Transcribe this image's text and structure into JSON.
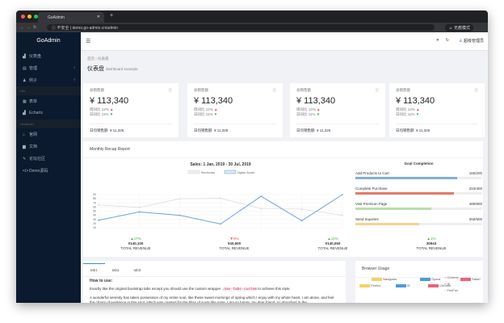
{
  "browser": {
    "tab_title": "GoAdmin",
    "url_security": "不安全",
    "url": "demo.go-admin.cn/admin",
    "profile": "无痕模式"
  },
  "sidebar": {
    "logo": "GoAdmin",
    "items": [
      {
        "label": "仪表盘",
        "icon": "dashboard-icon"
      },
      {
        "label": "管理",
        "icon": "table-icon",
        "chevron": "‹"
      },
      {
        "label": "例子",
        "icon": "user-icon",
        "chevron": "‹"
      }
    ],
    "header1": "Life",
    "items2": [
      {
        "label": "表单",
        "icon": "form-icon"
      },
      {
        "label": "Echarts",
        "icon": "chart-icon"
      }
    ],
    "header2": "GoAdmin",
    "items3": [
      {
        "label": "官网",
        "icon": "home-icon"
      },
      {
        "label": "文档",
        "icon": "doc-icon"
      },
      {
        "label": "论坛社区",
        "icon": "forum-icon"
      },
      {
        "label": "Demo源码",
        "icon": "code-icon"
      }
    ]
  },
  "header": {
    "user": "超级管理员"
  },
  "breadcrumb": [
    "首页",
    "仪表盘"
  ],
  "page": {
    "title": "仪表盘",
    "subtitle": "dashboard example"
  },
  "cards": [
    {
      "title": "总销售额",
      "value": "¥ 113,340",
      "wow_label": "周同比",
      "wow": "12%",
      "dod_label": "日同比",
      "dod": "11%",
      "footer_label": "日均销售额",
      "footer_value": "¥ 11,325"
    },
    {
      "title": "总销售额",
      "value": "¥ 113,340",
      "wow_label": "周同比",
      "wow": "12%",
      "dod_label": "日同比",
      "dod": "11%",
      "footer_label": "日均销售额",
      "footer_value": "¥ 11,325"
    },
    {
      "title": "总销售额",
      "value": "¥ 113,340",
      "wow_label": "周同比",
      "wow": "12%",
      "dod_label": "日同比",
      "dod": "11%",
      "footer_label": "日均销售额",
      "footer_value": "¥ 11,325"
    },
    {
      "title": "总销售额",
      "value": "¥ 113,340",
      "wow_label": "周同比",
      "wow": "12%",
      "dod_label": "日同比",
      "dod": "11%",
      "footer_label": "日均销售额",
      "footer_value": "¥ 11,325"
    }
  ],
  "report": {
    "title": "Monthly Recap Report",
    "goal_title": "Goal Completion",
    "goals": [
      {
        "label": "Add Products to Cart",
        "value": "160/200",
        "pct": 80,
        "color": "#7fb0d6"
      },
      {
        "label": "Complete Purchase",
        "value": "310/400",
        "pct": 77.5,
        "color": "#e07a6a"
      },
      {
        "label": "Visit Premium Page",
        "value": "480/800",
        "pct": 60,
        "color": "#b8ddb0"
      },
      {
        "label": "Send Inquiries",
        "value": "250/500",
        "pct": 50,
        "color": "#f6d48c"
      }
    ],
    "revenue": [
      {
        "change": "▲17%",
        "amount": "¥140,100",
        "label": "TOTAL REVENUE",
        "color": "#4a4"
      },
      {
        "change": "▼0%",
        "amount": "¥40,500",
        "label": "TOTAL REVENUE",
        "color": "#e44"
      },
      {
        "change": "▲12%",
        "amount": "¥140,050",
        "label": "TOTAL REVENUE",
        "color": "#4a4"
      },
      {
        "change": "▲1%",
        "amount": "30943",
        "label": "TOTAL REVENUE",
        "color": "#4a4"
      }
    ]
  },
  "chart_data": {
    "type": "line",
    "title": "Sales: 1 Jan, 2019 - 30 Jul, 2019",
    "categories": [
      "January",
      "February",
      "March",
      "April",
      "May",
      "June",
      "July"
    ],
    "ylim": [
      10,
      90
    ],
    "yticks": [
      10,
      20,
      30,
      40,
      50,
      60,
      70,
      80,
      90
    ],
    "grid": true,
    "legend": "top",
    "series": [
      {
        "name": "Electronics",
        "values": [
          65,
          59,
          80,
          81,
          56,
          55,
          40
        ],
        "color": "#d8d8d8"
      },
      {
        "name": "Digital Goods",
        "values": [
          28,
          48,
          40,
          19,
          86,
          27,
          90
        ],
        "color": "#6f9fd8"
      }
    ]
  },
  "tabs": {
    "items": [
      "tab1",
      "tab2",
      "tab3"
    ],
    "heading": "How to use:",
    "p1a": "Exactly like the original bootstrap tabs except you should use the custom wrapper",
    "p1code": ".nav-tabs-custom",
    "p1b": "to achieve this style.",
    "p2": "A wonderful serenity has taken possession of my entire soul, like these sweet mornings of spring which I enjoy with my whole heart. I am alone, and feel the charm of existence in this spot, which was created for the bliss of souls like mine. I am so happy, my dear friend, so absorbed in the"
  },
  "browser_usage": {
    "title": "Browser Usage",
    "legend": [
      {
        "label": "Navigator",
        "color": "#f6d06a"
      },
      {
        "label": "Opera",
        "color": "#4a9be0"
      },
      {
        "label": "Safari",
        "color": "#e8647a"
      },
      {
        "label": "Firefox",
        "color": "#f6d06a"
      },
      {
        "label": "IE",
        "color": "#4a9be0"
      },
      {
        "label": "Chrome",
        "color": "#e8647a"
      }
    ],
    "list": [
      {
        "label": "Chrome",
        "color": "#e44"
      },
      {
        "label": "IE",
        "color": "#333"
      },
      {
        "label": "FireFox",
        "color": "#f0b030"
      }
    ]
  }
}
